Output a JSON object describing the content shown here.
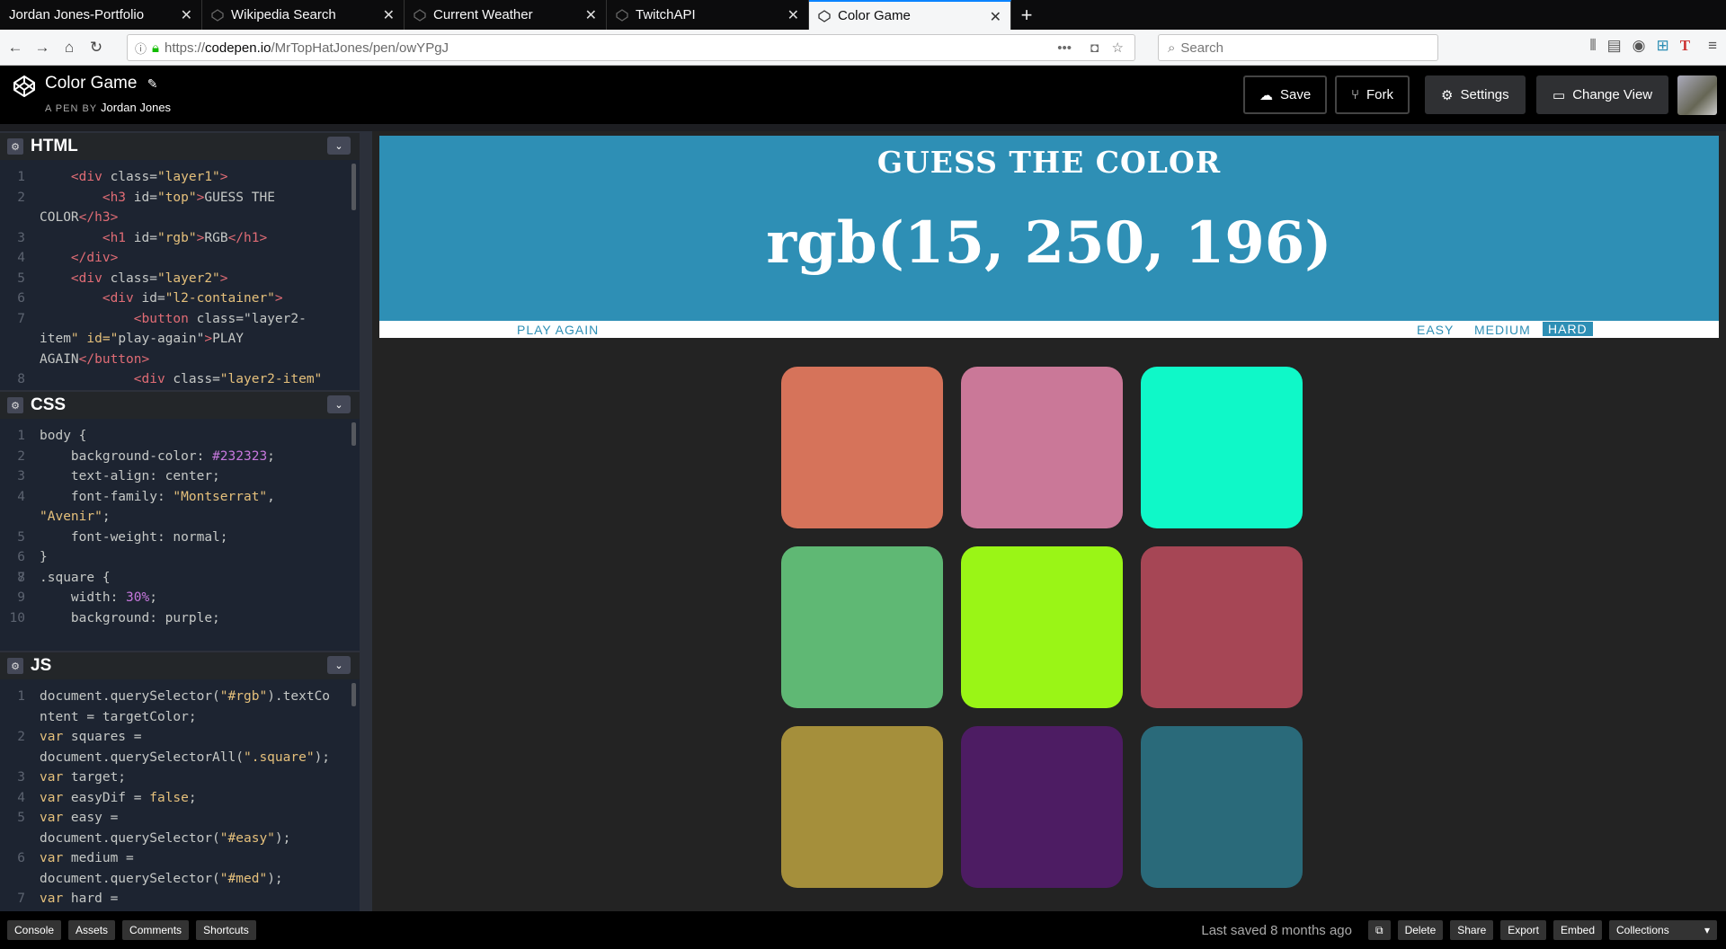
{
  "browser": {
    "tabs": [
      {
        "label": "Jordan Jones-Portfolio",
        "active": false
      },
      {
        "label": "Wikipedia Search",
        "active": false
      },
      {
        "label": "Current Weather",
        "active": false
      },
      {
        "label": "TwitchAPI",
        "active": false
      },
      {
        "label": "Color Game",
        "active": true
      }
    ],
    "url_prefix": "https://",
    "url_host": "codepen.io",
    "url_path": "/MrTopHatJones/pen/owYPgJ",
    "search_placeholder": "Search"
  },
  "header": {
    "title": "Color Game",
    "byline_prefix": "A PEN BY",
    "author": "Jordan Jones",
    "save": "Save",
    "fork": "Fork",
    "settings": "Settings",
    "change_view": "Change View"
  },
  "editors": {
    "html": {
      "title": "HTML",
      "lines": [
        {
          "n": "1",
          "text": "    <div class=\"layer1\">"
        },
        {
          "n": "2",
          "text": "        <h3 id=\"top\">GUESS THE"
        },
        {
          "n": "",
          "text": "COLOR</h3>"
        },
        {
          "n": "3",
          "text": "        <h1 id=\"rgb\">RGB</h1>"
        },
        {
          "n": "4",
          "text": "    </div>"
        },
        {
          "n": "5",
          "text": "    <div class=\"layer2\">"
        },
        {
          "n": "6",
          "text": "        <div id=\"l2-container\">"
        },
        {
          "n": "7",
          "text": "            <button class=\"layer2-"
        },
        {
          "n": "",
          "text": "item\" id=\"play-again\">PLAY"
        },
        {
          "n": "",
          "text": "AGAIN</button>"
        },
        {
          "n": "8",
          "text": "            <div class=\"layer2-item\""
        }
      ]
    },
    "css": {
      "title": "CSS",
      "lines": [
        {
          "n": "1",
          "text": "body {"
        },
        {
          "n": "2",
          "text": "    background-color: #232323;"
        },
        {
          "n": "3",
          "text": "    text-align: center;"
        },
        {
          "n": "4",
          "text": "    font-family: \"Montserrat\","
        },
        {
          "n": "",
          "text": "\"Avenir\";"
        },
        {
          "n": "5",
          "text": "    font-weight: normal;"
        },
        {
          "n": "6",
          "text": "}"
        },
        {
          "n": "7",
          "text": ""
        },
        {
          "n": "8",
          "text": ".square {"
        },
        {
          "n": "9",
          "text": "    width: 30%;"
        },
        {
          "n": "10",
          "text": "    background: purple;"
        }
      ]
    },
    "js": {
      "title": "JS",
      "lines": [
        {
          "n": "1",
          "text": "document.querySelector(\"#rgb\").textCo"
        },
        {
          "n": "",
          "text": "ntent = targetColor;"
        },
        {
          "n": "2",
          "text": "var squares ="
        },
        {
          "n": "",
          "text": "document.querySelectorAll(\".square\");"
        },
        {
          "n": "3",
          "text": "var target;"
        },
        {
          "n": "4",
          "text": "var easyDif = false;"
        },
        {
          "n": "5",
          "text": "var easy ="
        },
        {
          "n": "",
          "text": "document.querySelector(\"#easy\");"
        },
        {
          "n": "6",
          "text": "var medium ="
        },
        {
          "n": "",
          "text": "document.querySelector(\"#med\");"
        },
        {
          "n": "7",
          "text": "var hard ="
        }
      ]
    }
  },
  "preview": {
    "heading": "GUESS THE COLOR",
    "rgb": "rgb(15, 250, 196)",
    "play_again": "PLAY AGAIN",
    "easy": "EASY",
    "medium": "MEDIUM",
    "hard": "HARD",
    "selected_difficulty": "HARD",
    "square_colors": [
      "#d6735a",
      "#ca7898",
      "#0ff8c8",
      "#5fb874",
      "#9af516",
      "#a64655",
      "#a58f3b",
      "#4d1c63",
      "#2a6a7a"
    ]
  },
  "footer": {
    "console": "Console",
    "assets": "Assets",
    "comments": "Comments",
    "shortcuts": "Shortcuts",
    "last_saved": "Last saved 8 months ago",
    "delete": "Delete",
    "share": "Share",
    "export": "Export",
    "embed": "Embed",
    "collections": "Collections"
  }
}
